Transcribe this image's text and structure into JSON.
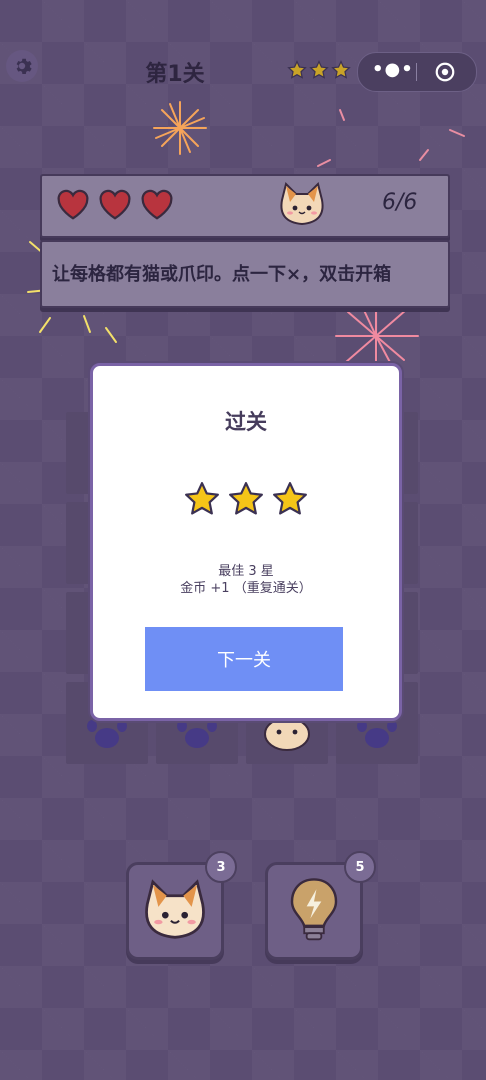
{
  "header": {
    "level_title": "第1关",
    "stars_earned": 3,
    "stars_total": 3
  },
  "icons": {
    "settings": "gear-icon",
    "more": "more-dots-icon",
    "close": "target-close-icon",
    "heart": "heart-icon",
    "cat": "cat-face-icon",
    "paw": "paw-icon",
    "bulb": "lightbulb-icon",
    "star": "star-icon"
  },
  "status": {
    "hearts_remaining": 3,
    "counter": "6/6"
  },
  "hint": {
    "text": "让每格都有猫或爪印。点一下×，双击开箱"
  },
  "dialog": {
    "title": "过关",
    "stars": 3,
    "best_line": "最佳 3 星",
    "coins_line": "金币 +1 （重复通关）",
    "next_button": "下一关"
  },
  "tools": {
    "cat_count": "3",
    "bulb_count": "5"
  },
  "colors": {
    "background": "#5b4d72",
    "button": "#6f8ff5",
    "star": "#f5c518",
    "heart": "#b8343e"
  }
}
